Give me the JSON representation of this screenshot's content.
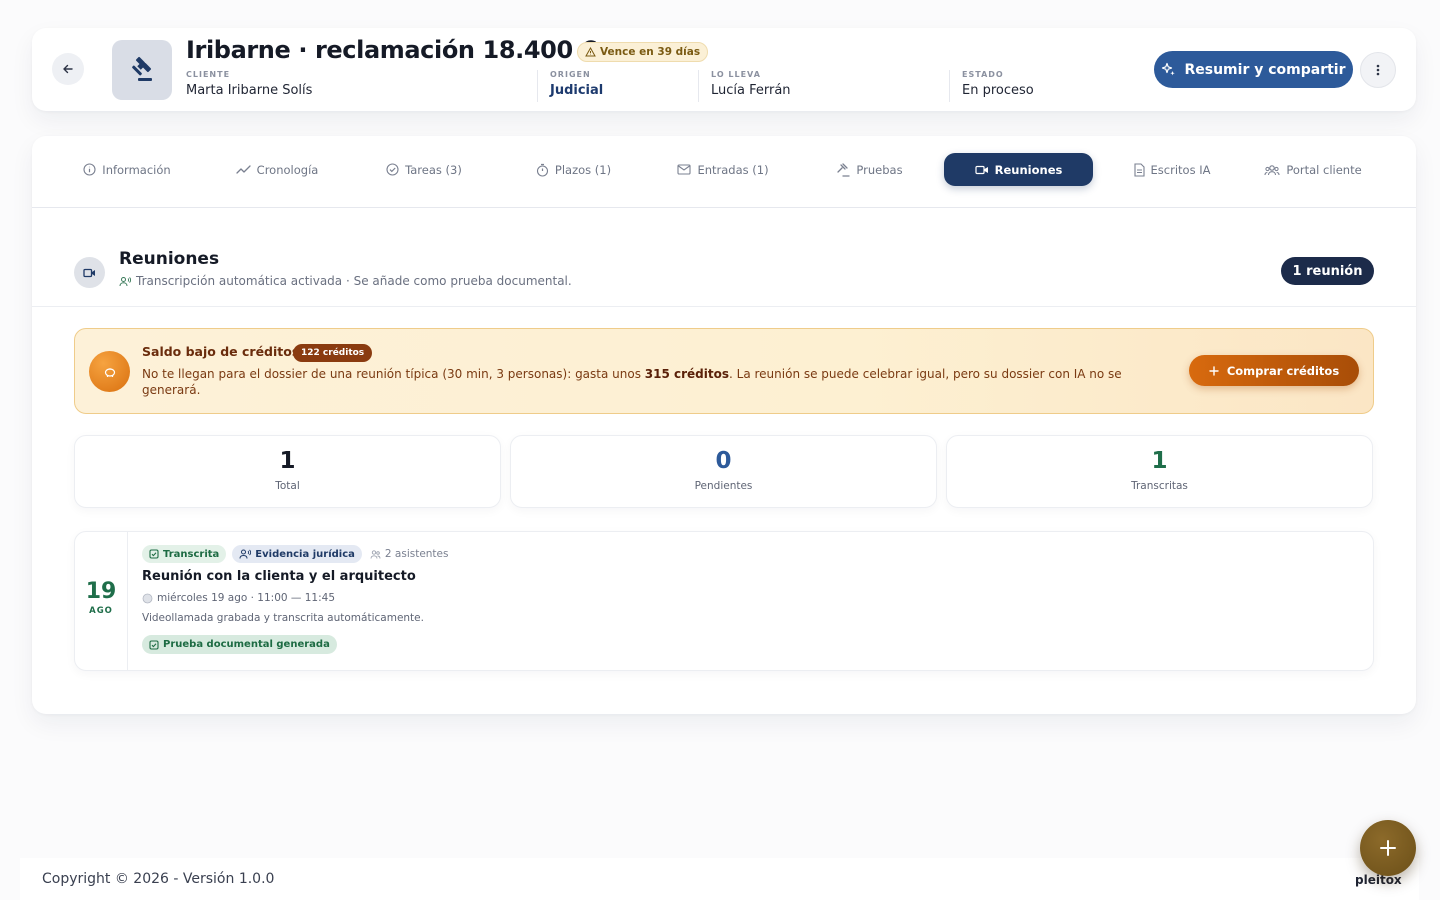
{
  "header": {
    "title": "Iribarne · reclamación 18.400 €",
    "due_badge": "Vence en 39 días",
    "meta": [
      {
        "key": "CLIENTE",
        "value": "Marta Iribarne Solís"
      },
      {
        "key": "ORIGEN",
        "value": "Judicial"
      },
      {
        "key": "LO LLEVA",
        "value": "Lucía Ferrán"
      },
      {
        "key": "ESTADO",
        "value": "En proceso"
      }
    ],
    "share_label": "Resumir y compartir"
  },
  "tabs": [
    {
      "label": "Información",
      "icon": "info-icon"
    },
    {
      "label": "Cronología",
      "icon": "trend-icon"
    },
    {
      "label": "Tareas (3)",
      "icon": "check-circle-icon"
    },
    {
      "label": "Plazos (1)",
      "icon": "stopwatch-icon"
    },
    {
      "label": "Entradas (1)",
      "icon": "mail-icon"
    },
    {
      "label": "Pruebas",
      "icon": "gavel-icon"
    },
    {
      "label": "Reuniones",
      "icon": "video-icon",
      "active": true
    },
    {
      "label": "Escritos IA",
      "icon": "document-icon"
    },
    {
      "label": "Portal cliente",
      "icon": "users-icon"
    }
  ],
  "section": {
    "title": "Reuniones",
    "subtitle": "Transcripción automática activada · Se añade como prueba documental.",
    "count_label": "1 reunión"
  },
  "alert": {
    "title": "Saldo bajo de créditos",
    "badge": "122 créditos",
    "text_before": "No te llegan para el dossier de una reunión típica (30 min, 3 personas): gasta unos ",
    "text_bold": "315 créditos",
    "text_after": ". La reunión se puede celebrar igual, pero su dossier con IA no se generará.",
    "button_label": "Comprar créditos"
  },
  "stats": [
    {
      "value": "1",
      "label": "Total",
      "color": "#151a26"
    },
    {
      "value": "0",
      "label": "Pendientes",
      "color": "#2d5a9a"
    },
    {
      "value": "1",
      "label": "Transcritas",
      "color": "#1f6e4a"
    }
  ],
  "meeting": {
    "day": "19",
    "month": "AGO",
    "tag_status": "Transcrita",
    "tag_evidence": "Evidencia jurídica",
    "attendees": "2 asistentes",
    "title": "Reunión con la clienta y el arquitecto",
    "time": "miércoles 19 ago · 11:00 — 11:45",
    "description": "Videollamada grabada y transcrita automáticamente.",
    "proof_label": "Prueba documental generada"
  },
  "footer": {
    "copyright": "Copyright © 2026 - Versión 1.0.0",
    "brand": "pleitox"
  },
  "colors": {
    "primary": "#2d5a9a",
    "navy": "#1f3a66",
    "green": "#1f6e4a",
    "warning": "#d86a0e"
  }
}
